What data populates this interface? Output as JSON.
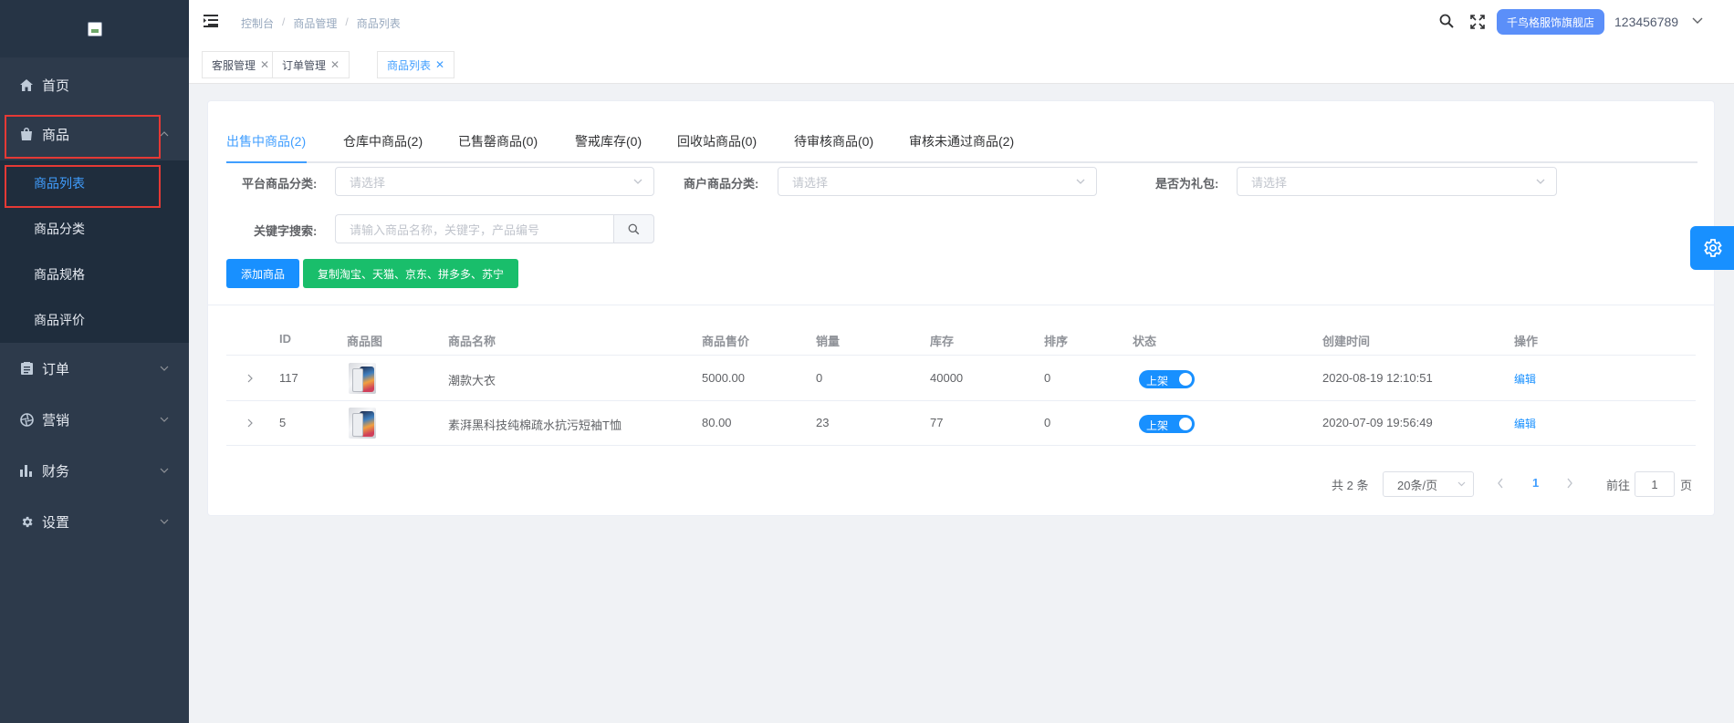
{
  "sidebar": {
    "menu": [
      {
        "label": "首页",
        "icon": "home-icon"
      },
      {
        "label": "商品",
        "icon": "bag-icon"
      },
      {
        "label": "订单",
        "icon": "clipboard-icon"
      },
      {
        "label": "营销",
        "icon": "aperture-icon"
      },
      {
        "label": "财务",
        "icon": "bar-chart-icon"
      },
      {
        "label": "设置",
        "icon": "gear-icon"
      }
    ],
    "submenu": [
      {
        "label": "商品列表",
        "active": true
      },
      {
        "label": "商品分类",
        "active": false
      },
      {
        "label": "商品规格",
        "active": false
      },
      {
        "label": "商品评价",
        "active": false
      }
    ]
  },
  "header": {
    "breadcrumb": [
      "控制台",
      "商品管理",
      "商品列表"
    ],
    "store_label": "千鸟格服饰旗舰店",
    "username": "123456789"
  },
  "tags": [
    {
      "label": "客服管理",
      "active": false
    },
    {
      "label": "订单管理",
      "active": false
    },
    {
      "label": "商品列表",
      "active": true
    }
  ],
  "tabs": [
    "出售中商品(2)",
    "仓库中商品(2)",
    "已售罄商品(0)",
    "警戒库存(0)",
    "回收站商品(0)",
    "待审核商品(0)",
    "审核未通过商品(2)"
  ],
  "filters": {
    "platform_label": "平台商品分类:",
    "platform_placeholder": "请选择",
    "merchant_label": "商户商品分类:",
    "merchant_placeholder": "请选择",
    "gift_label": "是否为礼包:",
    "gift_placeholder": "请选择",
    "keyword_label": "关键字搜索:",
    "keyword_placeholder": "请输入商品名称，关键字，产品编号"
  },
  "actions": {
    "add_label": "添加商品",
    "copy_label": "复制淘宝、天猫、京东、拼多多、苏宁"
  },
  "table": {
    "headers": [
      "ID",
      "商品图",
      "商品名称",
      "商品售价",
      "销量",
      "库存",
      "排序",
      "状态",
      "创建时间",
      "操作"
    ],
    "rows": [
      {
        "id": "117",
        "name": "潮款大衣",
        "price": "5000.00",
        "sales": "0",
        "stock": "40000",
        "sort": "0",
        "status": "上架",
        "created": "2020-08-19 12:10:51",
        "action": "编辑"
      },
      {
        "id": "5",
        "name": "素湃黑科技纯棉疏水抗污短袖T恤",
        "price": "80.00",
        "sales": "23",
        "stock": "77",
        "sort": "0",
        "status": "上架",
        "created": "2020-07-09 19:56:49",
        "action": "编辑"
      }
    ]
  },
  "pagination": {
    "total": "共 2 条",
    "page_size": "20条/页",
    "current": "1",
    "goto_label": "前往",
    "goto_value": "1",
    "page_suffix": "页"
  },
  "colors": {
    "sidebar_bg": "#2d3a4b",
    "primary": "#1890ff",
    "success": "#19be6b",
    "highlight": "#e53935"
  }
}
